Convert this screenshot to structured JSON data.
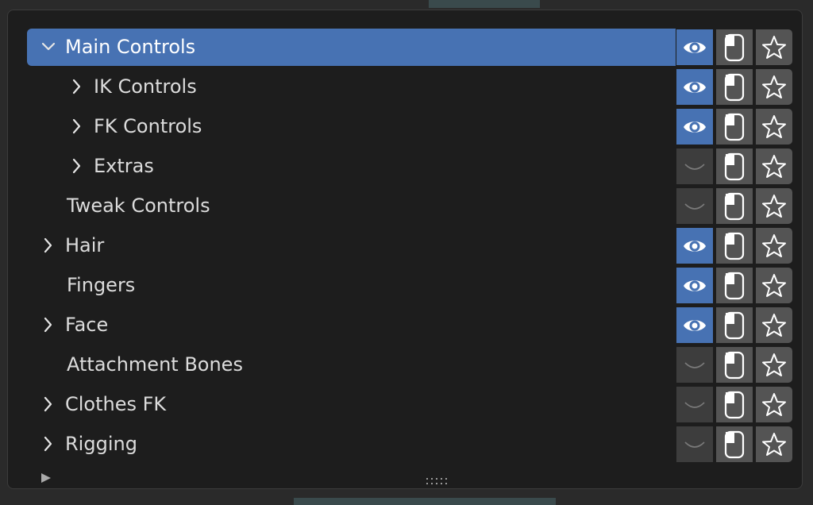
{
  "panel": {
    "rows": [
      {
        "label": "Main Controls",
        "indent": 0,
        "expander": "open",
        "selected": true,
        "visible": true
      },
      {
        "label": "IK Controls",
        "indent": 1,
        "expander": "closed",
        "selected": false,
        "visible": true
      },
      {
        "label": "FK Controls",
        "indent": 1,
        "expander": "closed",
        "selected": false,
        "visible": true
      },
      {
        "label": "Extras",
        "indent": 1,
        "expander": "closed",
        "selected": false,
        "visible": false
      },
      {
        "label": "Tweak Controls",
        "indent": 0,
        "expander": "none",
        "selected": false,
        "visible": false
      },
      {
        "label": "Hair",
        "indent": 0,
        "expander": "closed",
        "selected": false,
        "visible": true
      },
      {
        "label": "Fingers",
        "indent": 0,
        "expander": "none",
        "selected": false,
        "visible": true
      },
      {
        "label": "Face",
        "indent": 0,
        "expander": "closed",
        "selected": false,
        "visible": true
      },
      {
        "label": "Attachment Bones",
        "indent": 0,
        "expander": "none",
        "selected": false,
        "visible": false
      },
      {
        "label": "Clothes FK",
        "indent": 0,
        "expander": "closed",
        "selected": false,
        "visible": false
      },
      {
        "label": "Rigging",
        "indent": 0,
        "expander": "closed",
        "selected": false,
        "visible": false
      }
    ],
    "icons": {
      "visibility_on": "eye-icon",
      "visibility_off": "eye-closed-icon",
      "select": "mouse-icon",
      "favorite": "star-icon",
      "filter": "disclosure-triangle-icon",
      "resize": "grip-icon"
    }
  },
  "colors": {
    "accent": "#4772b3",
    "panel_bg": "#1d1d1d",
    "button_bg": "#545454",
    "text": "#dcdcdc"
  }
}
